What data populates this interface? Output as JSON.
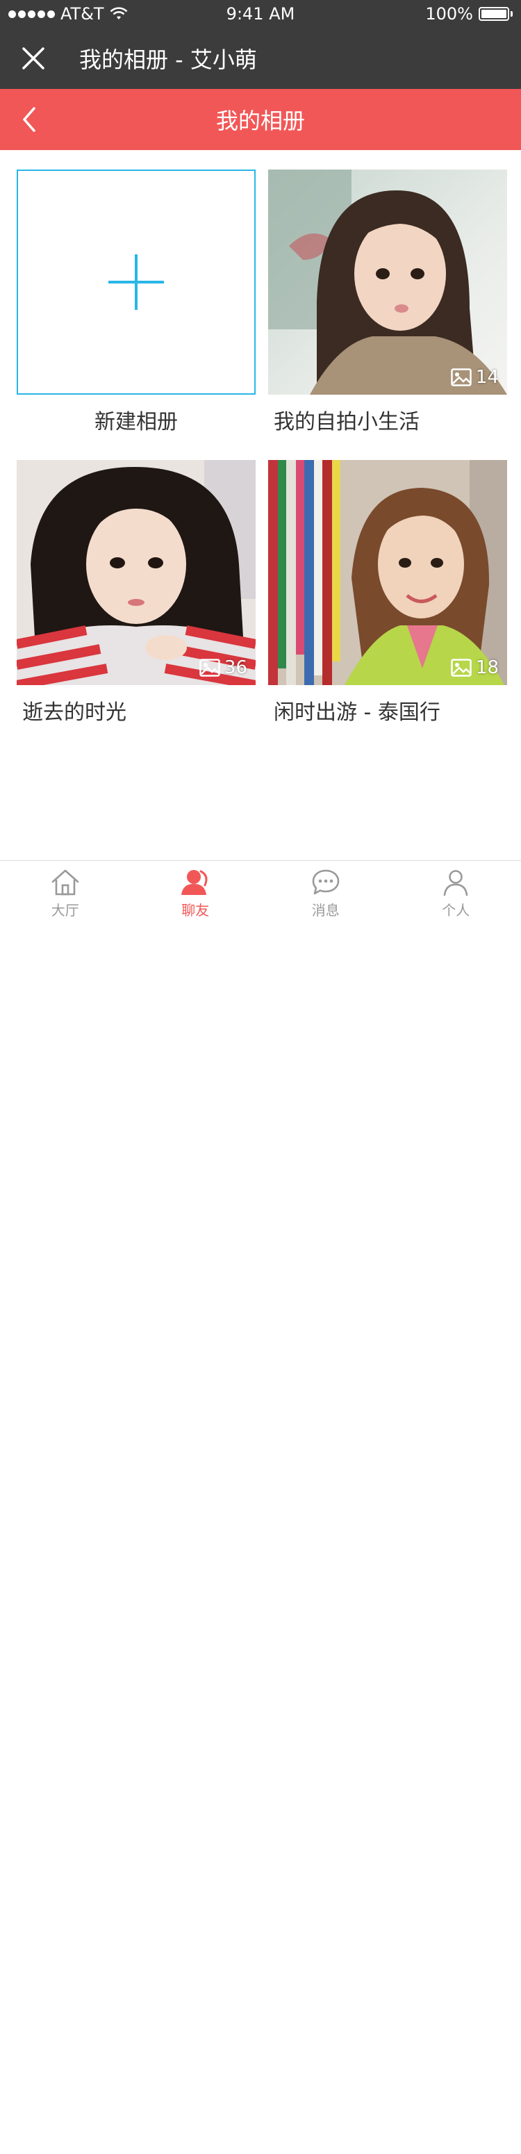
{
  "status_bar": {
    "carrier": "AT&T",
    "time": "9:41 AM",
    "battery": "100%"
  },
  "window": {
    "title": "我的相册 - 艾小萌"
  },
  "header": {
    "title": "我的相册"
  },
  "albums": [
    {
      "name": "新建相册"
    },
    {
      "name": "我的自拍小生活",
      "count": "14"
    },
    {
      "name": "逝去的时光",
      "count": "36"
    },
    {
      "name": "闲时出游 - 泰国行",
      "count": "18"
    }
  ],
  "tabs": [
    {
      "label": "大厅",
      "icon": "home-icon"
    },
    {
      "label": "聊友",
      "icon": "chat-friend-icon",
      "active": true
    },
    {
      "label": "消息",
      "icon": "message-icon"
    },
    {
      "label": "个人",
      "icon": "person-icon"
    }
  ],
  "colors": {
    "dark_bar": "#3c3c3c",
    "accent_red": "#f25757",
    "new_album_blue": "#29b6e8",
    "tab_inactive": "#999999"
  }
}
